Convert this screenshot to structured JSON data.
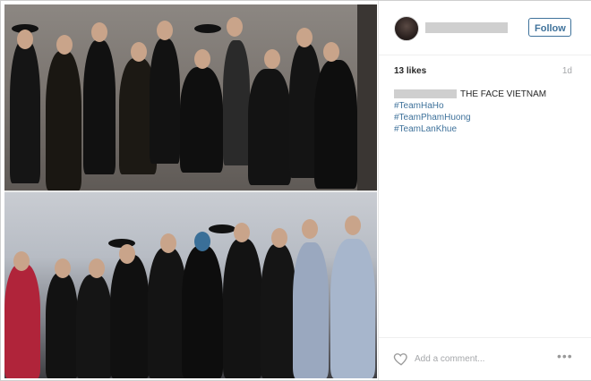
{
  "post": {
    "follow_label": "Follow",
    "likes": "13 likes",
    "age": "1d",
    "caption_text": "THE FACE VIETNAM",
    "hashtags": [
      "#TeamHaHo",
      "#TeamPhamHuong",
      "#TeamLanKhue"
    ],
    "comment_placeholder": "Add a comment...",
    "more_label": "•••"
  },
  "colors": {
    "link": "#3f729b",
    "text": "#262626",
    "muted": "#a5a7aa"
  },
  "icons": [
    "heart-icon",
    "more-options-icon"
  ]
}
